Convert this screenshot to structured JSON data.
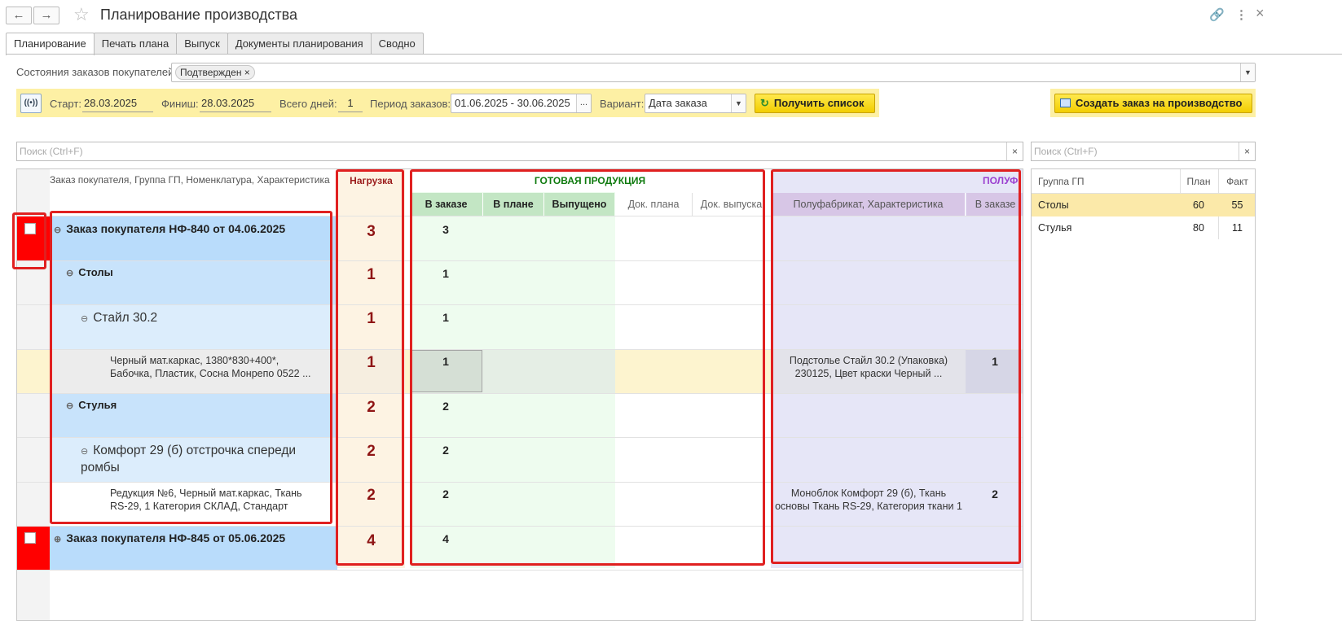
{
  "header": {
    "title": "Планирование производства",
    "back_icon": "←",
    "forward_icon": "→",
    "star_icon": "☆",
    "link_icon": "🔗",
    "more_icon": "⋮",
    "close_icon": "×"
  },
  "tabs": [
    {
      "label": "Планирование"
    },
    {
      "label": "Печать плана"
    },
    {
      "label": "Выпуск"
    },
    {
      "label": "Документы планирования"
    },
    {
      "label": "Сводно"
    }
  ],
  "filter": {
    "label": "Состояния заказов покупателей:",
    "chip": "Подтвержден",
    "chip_remove": "×"
  },
  "params": {
    "wifi_icon": "((•))",
    "start_label": "Старт:",
    "start_value": "28.03.2025",
    "finish_label": "Финиш:",
    "finish_value": "28.03.2025",
    "days_label": "Всего дней:",
    "days_value": "1",
    "period_label": "Период заказов:",
    "period_value": "01.06.2025 - 30.06.2025",
    "period_btn": "...",
    "variant_label": "Вариант:",
    "variant_value": "Дата заказа",
    "get_list_icon": "↻",
    "get_list_label": "Получить список",
    "create_order_label": "Создать заказ на производство"
  },
  "search": {
    "placeholder": "Поиск (Ctrl+F)",
    "clear": "×"
  },
  "grid": {
    "headers": {
      "order_col": "Заказ покупателя, Группа ГП, Номенклатура, Характеристика",
      "load": "Нагрузка",
      "finished_group": "ГОТОВАЯ ПРОДУКЦИЯ",
      "in_order": "В заказе",
      "in_plan": "В плане",
      "released": "Выпущено",
      "doc_plan": "Док. плана",
      "doc_release": "Док. выпуска",
      "semi_group": "ПОЛУФ",
      "semi_item": "Полуфабрикат, Характеристика",
      "semi_in_order": "В заказе"
    },
    "rows": [
      {
        "toggle": "⊖",
        "text": "Заказ покупателя НФ-840 от 04.06.2025",
        "load": "3",
        "in_order": "3",
        "semi_item": "",
        "semi_in_order": ""
      },
      {
        "toggle": "⊖",
        "text": "Столы",
        "load": "1",
        "in_order": "1",
        "semi_item": "",
        "semi_in_order": ""
      },
      {
        "toggle": "⊖",
        "text": "Стайл 30.2",
        "load": "1",
        "in_order": "1",
        "semi_item": "",
        "semi_in_order": ""
      },
      {
        "toggle": "",
        "text": "Черный мат.каркас, 1380*830+400*,\nБабочка, Пластик, Сосна Монрепо 0522 ...",
        "load": "1",
        "in_order": "1",
        "semi_item": "Подстолье Стайл 30.2 (Упаковка)\n230125, Цвет краски Черный ...",
        "semi_in_order": "1"
      },
      {
        "toggle": "⊖",
        "text": "Стулья",
        "load": "2",
        "in_order": "2",
        "semi_item": "",
        "semi_in_order": ""
      },
      {
        "toggle": "⊖",
        "text": "Комфорт 29 (б) отстрочка спереди\nромбы",
        "load": "2",
        "in_order": "2",
        "semi_item": "",
        "semi_in_order": ""
      },
      {
        "toggle": "",
        "text": "Редукция №6, Черный мат.каркас, Ткань\nRS-29, 1 Категория СКЛАД, Стандарт",
        "load": "2",
        "in_order": "2",
        "semi_item": "Моноблок Комфорт 29 (б), Ткань\nосновы Ткань RS-29, Категория ткани 1",
        "semi_in_order": "2"
      },
      {
        "toggle": "⊕",
        "text": "Заказ покупателя НФ-845 от 05.06.2025",
        "load": "4",
        "in_order": "4",
        "semi_item": "",
        "semi_in_order": ""
      }
    ]
  },
  "summary": {
    "headers": {
      "group": "Группа ГП",
      "plan": "План",
      "fact": "Факт"
    },
    "rows": [
      {
        "group": "Столы",
        "plan": "60",
        "fact": "55"
      },
      {
        "group": "Стулья",
        "plan": "80",
        "fact": "11"
      }
    ]
  },
  "colors": {
    "order_row": "#b9dcfb",
    "group_row": "#c8e3fb",
    "item_row": "#dcedfc",
    "load_col": "#fdf3e3",
    "finished_col": "#eefcef",
    "semi_col": "#e6e6f7",
    "highlight_row": "#fdf4cf",
    "marker_red": "#ff0000",
    "outline_red": "#e02020",
    "accent_yellow": "#fdf0a4"
  }
}
